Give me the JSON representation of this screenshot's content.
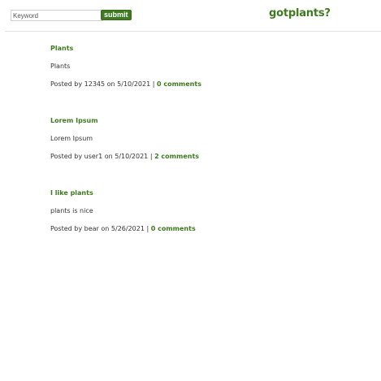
{
  "search": {
    "placeholder": "Keyword",
    "value": "",
    "submit_label": "submit"
  },
  "brand": {
    "name": "gotplants?"
  },
  "post_meta_text": {
    "posted_by": "Posted by",
    "on": "on",
    "separator": "|"
  },
  "posts": [
    {
      "title": "Plants",
      "body": "Plants",
      "author": "12345",
      "date": "5/10/2021",
      "comments": "0 comments"
    },
    {
      "title": "Lorem Ipsum",
      "body": "Lorem Ipsum",
      "author": "user1",
      "date": "5/10/2021",
      "comments": "2 comments"
    },
    {
      "title": "I like plants",
      "body": "plants is nice",
      "author": "bear",
      "date": "5/26/2021",
      "comments": "0 comments"
    }
  ],
  "colors": {
    "accent": "#3e7a1f",
    "text": "#333333",
    "divider": "#e2e2e2"
  }
}
